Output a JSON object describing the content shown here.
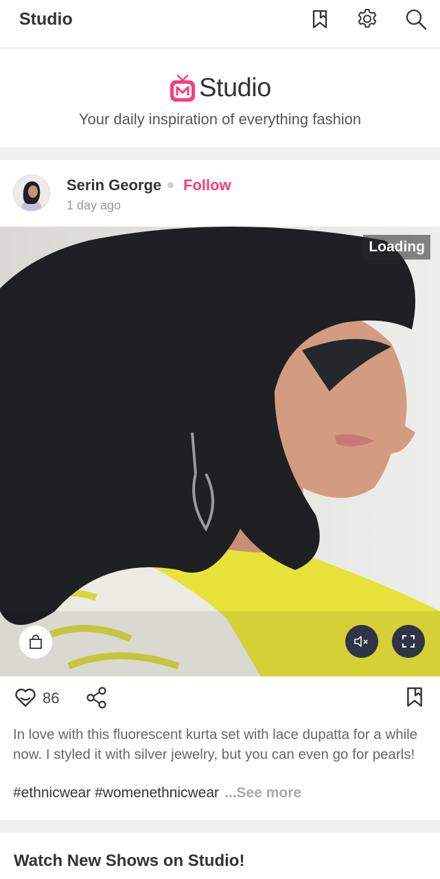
{
  "topbar": {
    "title": "Studio",
    "icons": [
      "bookmark-icon",
      "gear-icon",
      "search-icon"
    ]
  },
  "brand": {
    "logo_text": "Studio",
    "tagline": "Your daily inspiration of everything fashion",
    "accent": "#f43f7a"
  },
  "post": {
    "author": "Serin George",
    "follow_label": "Follow",
    "time": "1 day ago",
    "loading_label": "Loading",
    "likes": "86",
    "caption": "In love with this fluorescent kurta set with lace dupatta for a while now. I styled it with silver jewelry, but you can even go for pearls!",
    "hashtags": "#ethnicwear #womenethnicwear",
    "see_more": "...See more"
  },
  "section": {
    "title": "Watch New Shows on Studio!"
  }
}
